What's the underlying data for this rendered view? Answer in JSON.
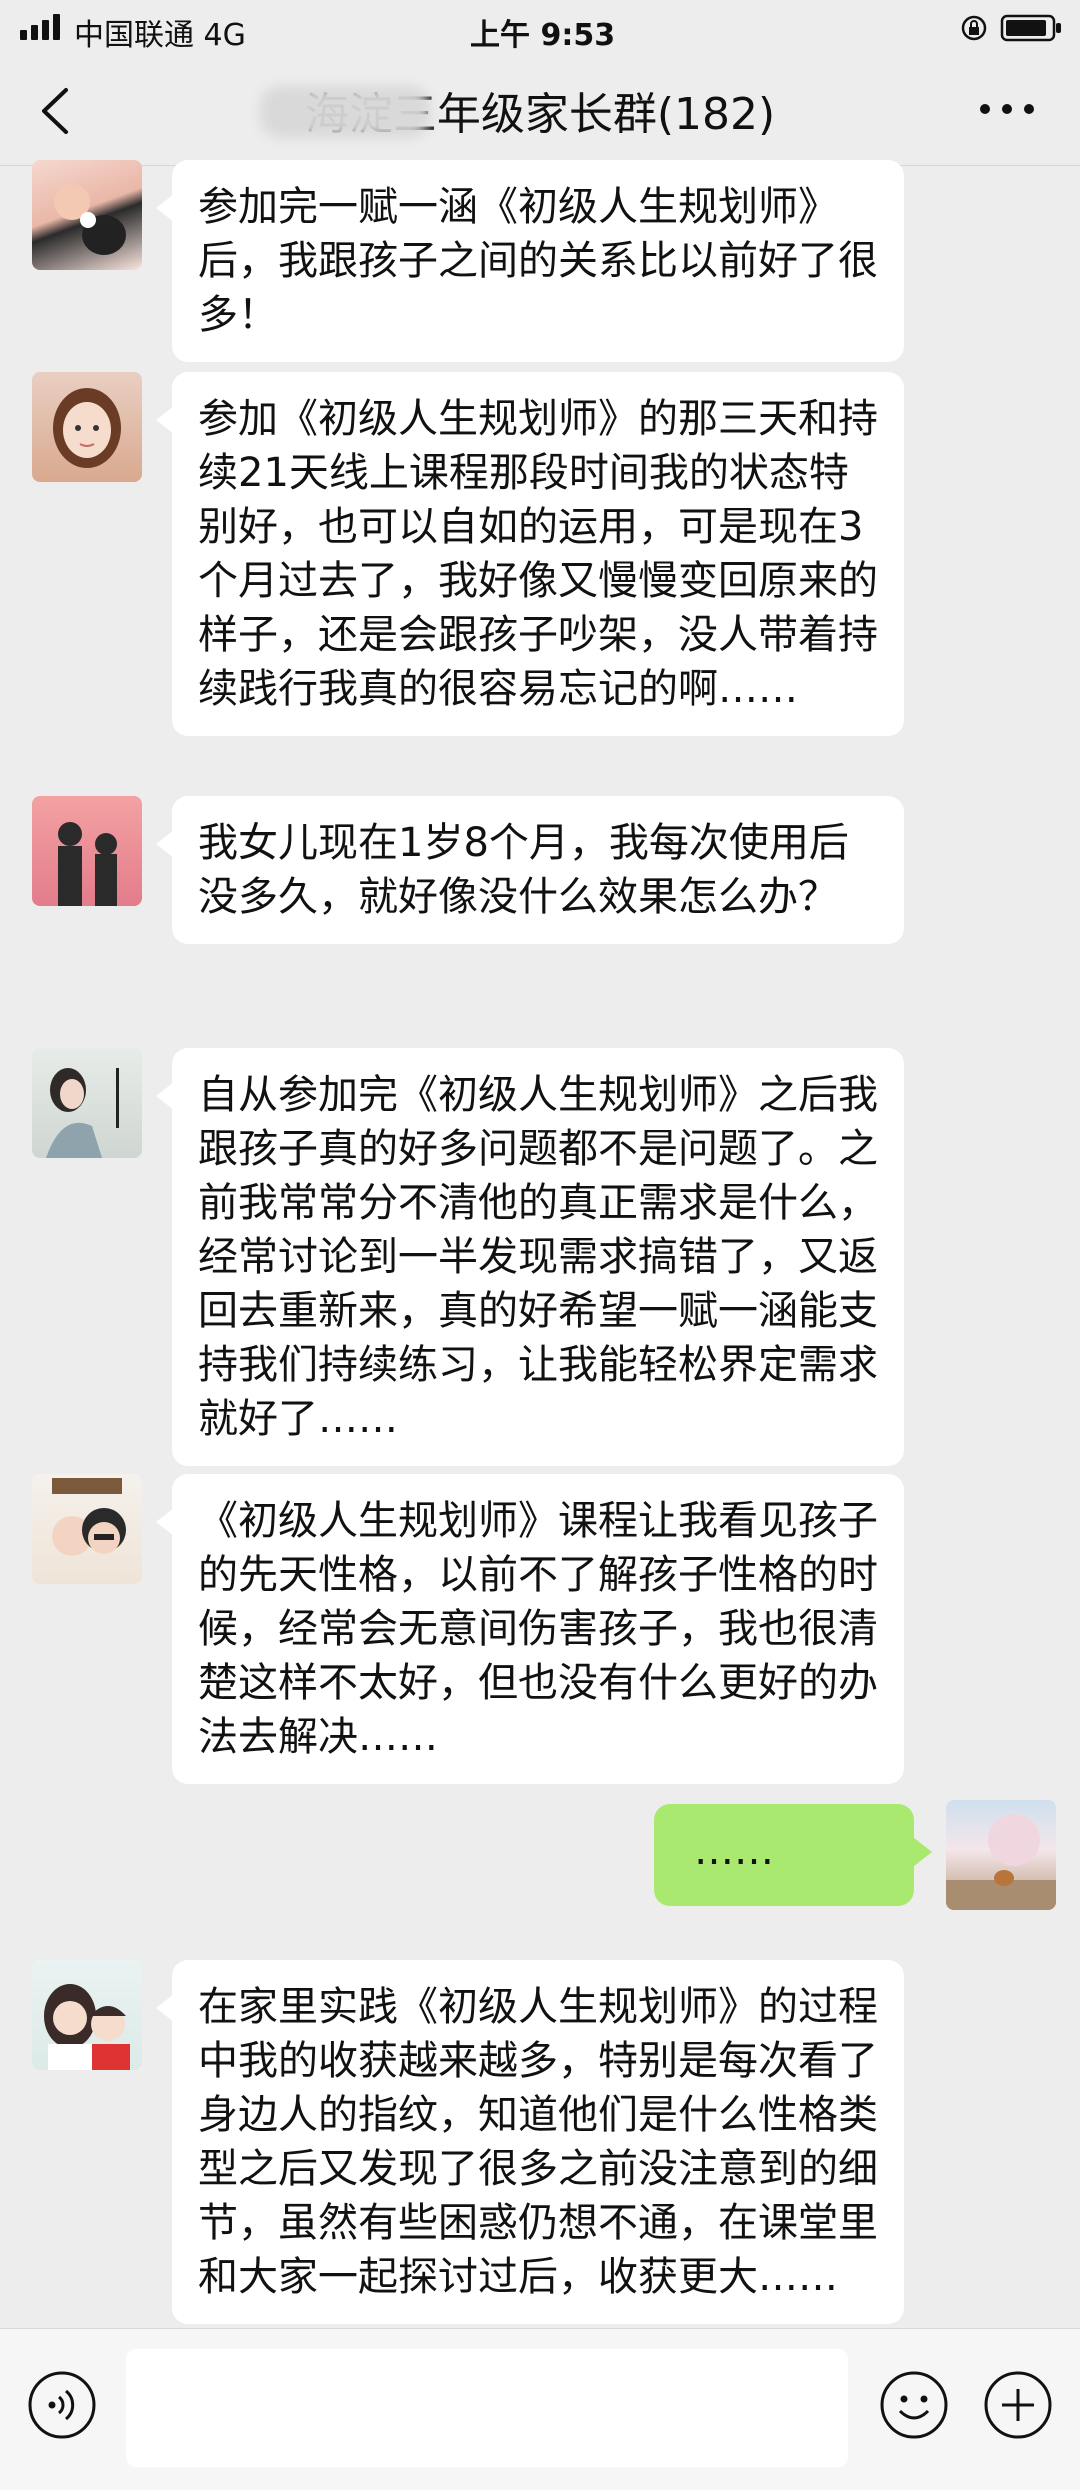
{
  "status_bar": {
    "carrier": "中国联通  4G",
    "time": "上午 9:53"
  },
  "header": {
    "title": "海淀三年级家长群(182)"
  },
  "messages": [
    {
      "side": "left",
      "text": "参加完一赋一涵《初级人生规划师》后，我跟孩子之间的关系比以前好了很多！"
    },
    {
      "side": "left",
      "text": "参加《初级人生规划师》的那三天和持续21天线上课程那段时间我的状态特别好，也可以自如的运用，可是现在3个月过去了，我好像又慢慢变回原来的样子，还是会跟孩子吵架，没人带着持续践行我真的很容易忘记的啊……"
    },
    {
      "side": "left",
      "text": "我女儿现在1岁8个月，我每次使用后没多久，就好像没什么效果怎么办？"
    },
    {
      "side": "left",
      "text": "自从参加完《初级人生规划师》之后我跟孩子真的好多问题都不是问题了。之前我常常分不清他的真正需求是什么，经常讨论到一半发现需求搞错了，又返回去重新来，真的好希望一赋一涵能支持我们持续练习，让我能轻松界定需求就好了……"
    },
    {
      "side": "left",
      "text": "《初级人生规划师》课程让我看见孩子的先天性格，以前不了解孩子性格的时候，经常会无意间伤害孩子，我也很清楚这样不太好，但也没有什么更好的办法去解决……"
    },
    {
      "side": "right",
      "text": "……"
    },
    {
      "side": "left",
      "text": "在家里实践《初级人生规划师》的过程中我的收获越来越多，特别是每次看了身边人的指纹，知道他们是什么性格类型之后又发现了很多之前没注意到的细节，虽然有些困惑仍想不通，在课堂里和大家一起探讨过后，收获更大……"
    }
  ],
  "colors": {
    "background": "#ededed",
    "bubble_left": "#ffffff",
    "bubble_right": "#a9e96f"
  },
  "icons": [
    "signal-icon",
    "lock-icon",
    "battery-icon",
    "back-icon",
    "more-icon",
    "voice-icon",
    "emoji-icon",
    "plus-icon"
  ]
}
